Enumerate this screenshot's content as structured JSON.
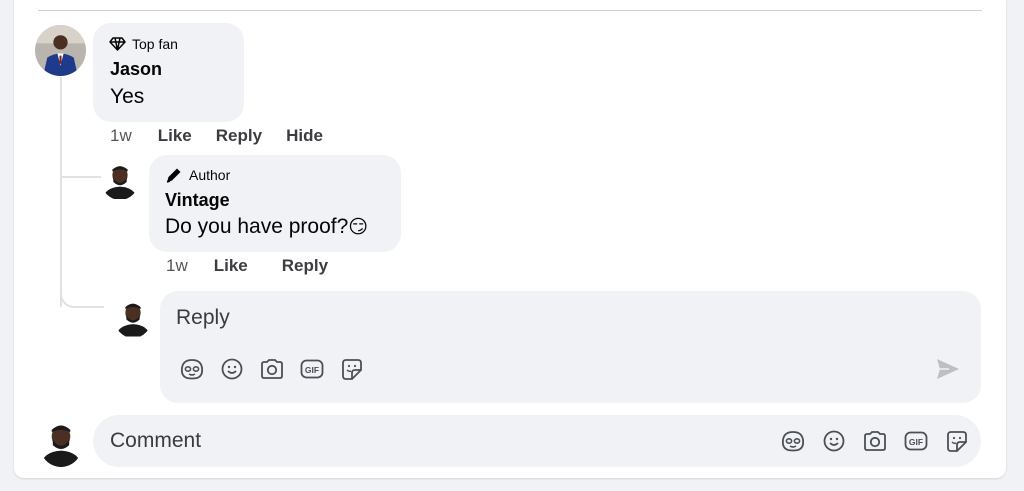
{
  "comments": [
    {
      "badge_icon": "diamond-icon",
      "badge": "Top fan",
      "author": "Jason",
      "text": "Yes",
      "time": "1w",
      "actions": [
        "Like",
        "Reply",
        "Hide"
      ]
    }
  ],
  "reply": {
    "badge_icon": "pencil-icon",
    "badge": "Author",
    "author": "Vintage",
    "text": "Do you have proof?",
    "emoji": "😏",
    "time": "1w",
    "actions": [
      "Like",
      "Reply"
    ]
  },
  "reply_composer": {
    "placeholder": "Reply",
    "tools": [
      "avatar-sticker-icon",
      "emoji-icon",
      "camera-icon",
      "gif-icon",
      "sticker-icon"
    ],
    "send_icon": "send-icon"
  },
  "comment_composer": {
    "placeholder": "Comment",
    "tools": [
      "avatar-sticker-icon",
      "emoji-icon",
      "camera-icon",
      "gif-icon",
      "sticker-icon"
    ]
  },
  "colors": {
    "bubble": "#f0f2f5",
    "text": "#050505",
    "muted": "#65676b",
    "line": "#dfe1e5",
    "jacket": "#1f3a8a"
  }
}
